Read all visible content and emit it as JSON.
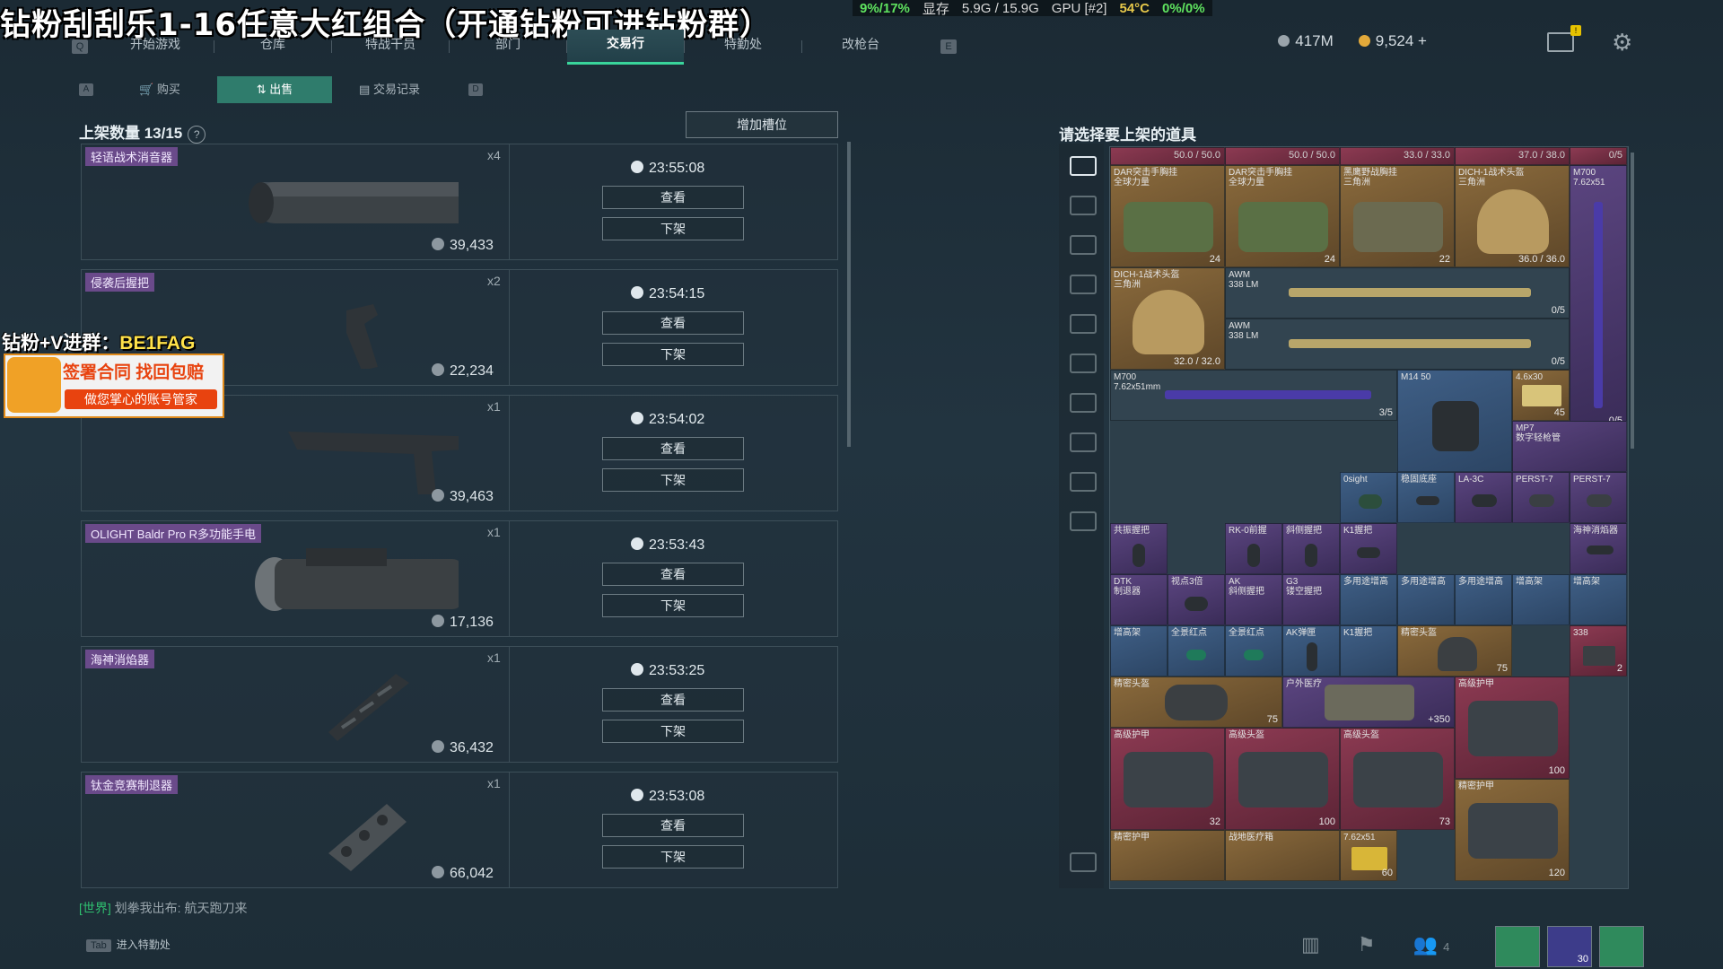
{
  "stream": {
    "title": "钻粉刮刮乐1-16任意大红组合（开通钻粉可进钻粉群）",
    "perf": {
      "cpu": "9%/17%",
      "vram_label": "显存",
      "vram": "5.9G / 15.9G",
      "gpu": "GPU [#2]",
      "temp": "54°C",
      "usage": "0%/0%"
    },
    "promo_prefix": "钻粉+V进群：",
    "promo_code": "BE1FAG",
    "promo_line1": "签署合同 找回包赔",
    "promo_line2": "做您掌心的账号管家"
  },
  "nav": {
    "tabs": [
      {
        "label": "开始游戏"
      },
      {
        "label": "仓库"
      },
      {
        "label": "特战干员"
      },
      {
        "label": "部门"
      },
      {
        "label": "交易行"
      },
      {
        "label": "特勤处"
      },
      {
        "label": "改枪台"
      }
    ],
    "active_index": 4,
    "key_left": "Q",
    "key_right": "E"
  },
  "currency": {
    "silver": "417M",
    "gold": "9,524 +"
  },
  "mail_badge": "!",
  "sub_tabs": {
    "items": [
      {
        "label": "购买"
      },
      {
        "label": "出售"
      },
      {
        "label": "交易记录"
      }
    ],
    "active_index": 1,
    "key_left": "A",
    "key_right": "D"
  },
  "listing": {
    "count_label": "上架数量 13/15",
    "help": "?",
    "add_slot_label": "增加槽位",
    "view_label": "查看",
    "remove_label": "下架",
    "items": [
      {
        "name": "轻语战术消音器",
        "qty": "x4",
        "price": "39,433",
        "timer": "23:55:08"
      },
      {
        "name": "侵袭后握把",
        "qty": "x2",
        "price": "22,234",
        "timer": "23:54:15"
      },
      {
        "name": "",
        "qty": "x1",
        "price": "39,463",
        "timer": "23:54:02"
      },
      {
        "name": "OLIGHT Baldr Pro R多功能手电",
        "qty": "x1",
        "price": "17,136",
        "timer": "23:53:43"
      },
      {
        "name": "海神消焰器",
        "qty": "x1",
        "price": "36,432",
        "timer": "23:53:25"
      },
      {
        "name": "钛金竞赛制退器",
        "qty": "x1",
        "price": "66,042",
        "timer": "23:53:08"
      }
    ]
  },
  "chat": {
    "channel": "[世界]",
    "text": "划拳我出布: 航天跑刀来"
  },
  "tab_hint": {
    "key": "Tab",
    "label": "进入特勤处"
  },
  "inventory": {
    "title": "请选择要上架的道具",
    "headers": [
      "50.0 / 50.0",
      "50.0 / 50.0",
      "33.0 / 33.0",
      "37.0 / 38.0",
      "0/5"
    ],
    "cells": [
      {
        "label": "DAR突击手胸挂",
        "sub": "全球力量",
        "num": "24"
      },
      {
        "label": "DAR突击手胸挂",
        "sub": "全球力量",
        "num": "24"
      },
      {
        "label": "黑鹰野战胸挂",
        "sub": "三角洲",
        "num": "22"
      },
      {
        "label": "DICH-1战术头盔",
        "sub": "三角洲",
        "num": "36.0 / 36.0"
      },
      {
        "label": "M700",
        "sub": "7.62x51",
        "num": "0/5"
      },
      {
        "label": "DICH-1战术头盔",
        "sub": "三角洲",
        "num": "32.0 / 32.0"
      },
      {
        "label": "AWM",
        "sub": "338 LM",
        "num": "0/5"
      },
      {
        "label": "AWM",
        "sub": "338 LM",
        "num": "0/5"
      },
      {
        "label": "M700",
        "sub": "7.62x51mm",
        "num": "3/5"
      },
      {
        "label": "M14 50",
        "sub": "",
        "num": ""
      },
      {
        "label": "4.6x30",
        "sub": "",
        "num": "45"
      },
      {
        "label": "MP7",
        "sub": "数字轻枪管",
        "num": ""
      },
      {
        "label": "0sight",
        "sub": "",
        "num": ""
      },
      {
        "label": "稳固底座",
        "sub": "",
        "num": ""
      },
      {
        "label": "LA-3C",
        "sub": "",
        "num": ""
      },
      {
        "label": "PERST-7",
        "sub": "",
        "num": ""
      },
      {
        "label": "PERST-7",
        "sub": "",
        "num": ""
      },
      {
        "label": "共振握把",
        "sub": "",
        "num": ""
      },
      {
        "label": "RK-0前握",
        "sub": "",
        "num": ""
      },
      {
        "label": "斜侧握把",
        "sub": "",
        "num": ""
      },
      {
        "label": "K1握把",
        "sub": "",
        "num": ""
      },
      {
        "label": "海神消焰器",
        "sub": "",
        "num": ""
      },
      {
        "label": "DTK",
        "sub": "制退器",
        "num": ""
      },
      {
        "label": "视点3倍",
        "sub": "",
        "num": ""
      },
      {
        "label": "AK",
        "sub": "斜侧握把",
        "num": ""
      },
      {
        "label": "G3",
        "sub": "镂空握把",
        "num": ""
      },
      {
        "label": "多用途增高",
        "sub": "",
        "num": ""
      },
      {
        "label": "多用途增高",
        "sub": "",
        "num": ""
      },
      {
        "label": "多用途增高",
        "sub": "",
        "num": ""
      },
      {
        "label": "增高架",
        "sub": "",
        "num": ""
      },
      {
        "label": "增高架",
        "sub": "",
        "num": ""
      },
      {
        "label": "增高架",
        "sub": "",
        "num": ""
      },
      {
        "label": "全景红点",
        "sub": "",
        "num": ""
      },
      {
        "label": "全景红点",
        "sub": "",
        "num": ""
      },
      {
        "label": "AK弹匣",
        "sub": "",
        "num": ""
      },
      {
        "label": "K1握把",
        "sub": "",
        "num": ""
      },
      {
        "label": "精密头盔",
        "sub": "",
        "num": "75"
      },
      {
        "label": "338",
        "sub": "",
        "num": "2"
      },
      {
        "label": "精密头盔",
        "sub": "",
        "num": "75"
      },
      {
        "label": "户外医疗",
        "sub": "",
        "num": "+350"
      },
      {
        "label": "高级护甲",
        "sub": "",
        "num": "100"
      },
      {
        "label": "高级护甲",
        "sub": "",
        "num": "32"
      },
      {
        "label": "高级头盔",
        "sub": "",
        "num": "100"
      },
      {
        "label": "高级头盔",
        "sub": "",
        "num": "73"
      },
      {
        "label": "精密护甲",
        "sub": "",
        "num": "120"
      },
      {
        "label": "精密护甲",
        "sub": "",
        "num": ""
      },
      {
        "label": "战地医疗箱",
        "sub": "",
        "num": ""
      },
      {
        "label": "7.62x51",
        "sub": "",
        "num": "60"
      }
    ]
  },
  "bottom": {
    "friends_count": "4",
    "slot_value": "30"
  }
}
